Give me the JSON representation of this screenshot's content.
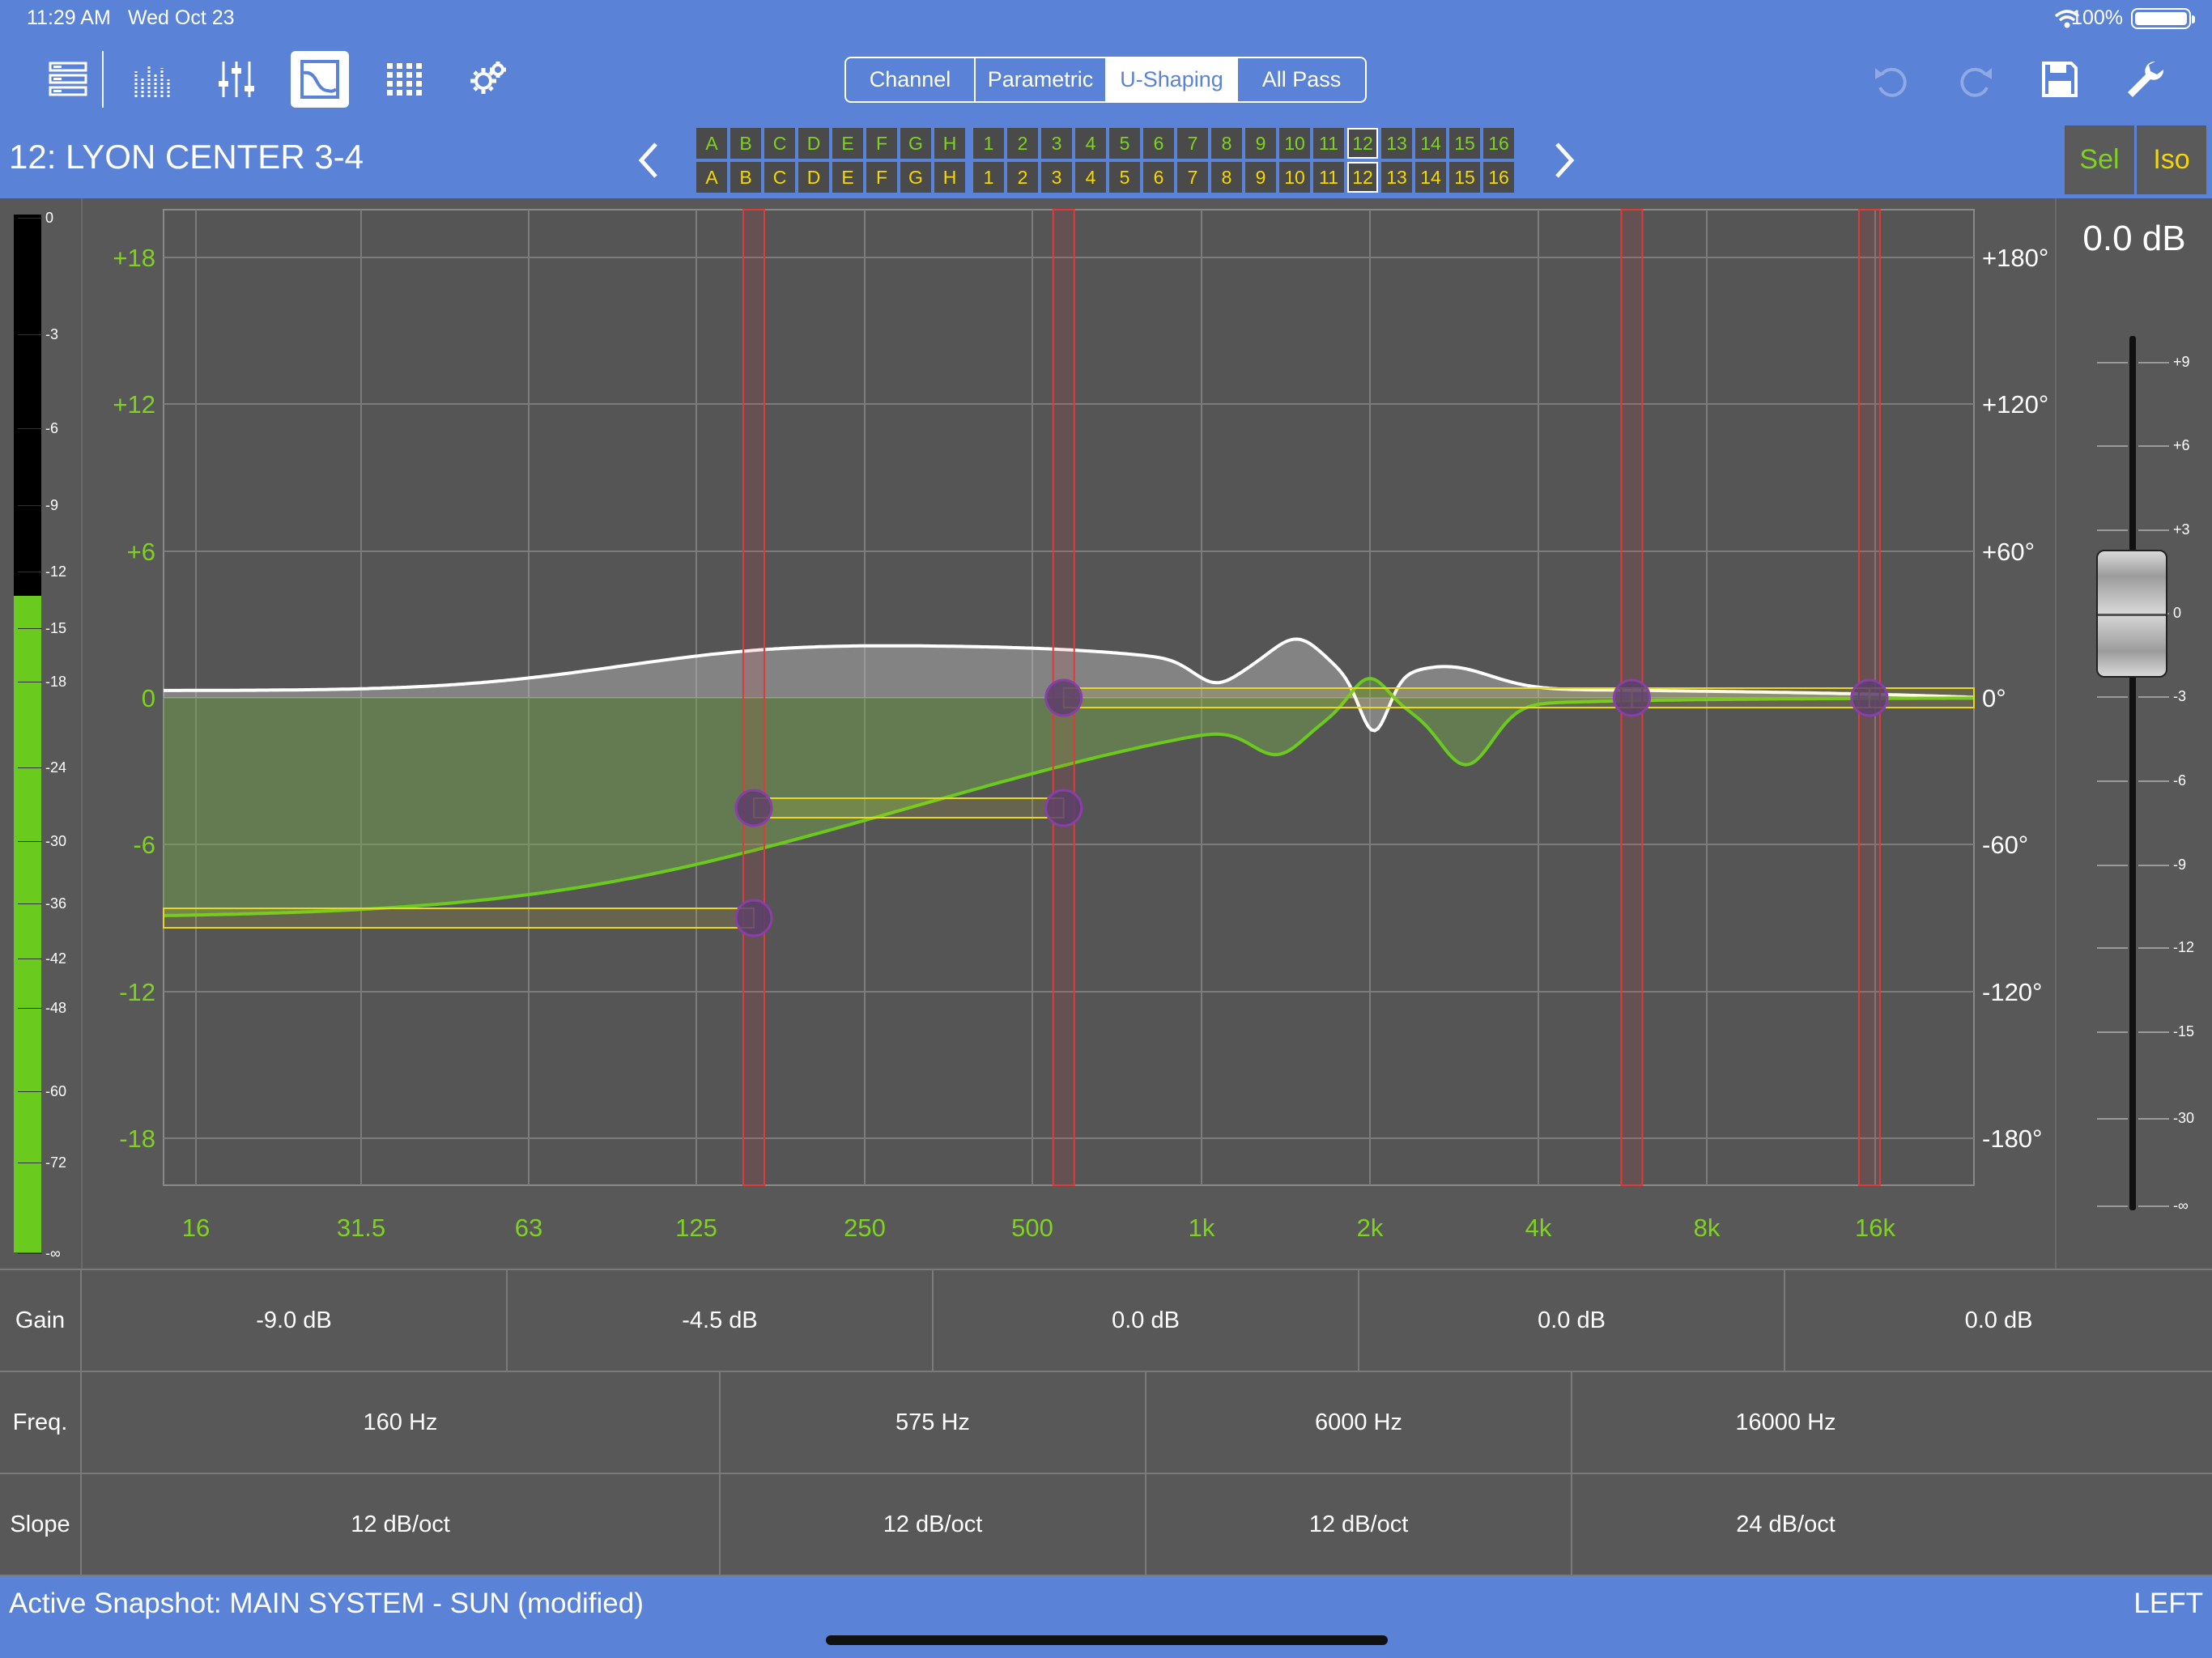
{
  "status_bar": {
    "time": "11:29 AM",
    "date": "Wed Oct 23",
    "battery": "100%"
  },
  "toolbar": {
    "left_icons": [
      "rack-icon",
      "spectrum-icon",
      "faders-icon",
      "eq-curve-icon",
      "matrix-grid-icon",
      "settings-gears-icon"
    ],
    "active_icon": "eq-curve-icon",
    "tabs": [
      {
        "label": "Channel",
        "active": false
      },
      {
        "label": "Parametric",
        "active": false
      },
      {
        "label": "U-Shaping",
        "active": true
      },
      {
        "label": "All Pass",
        "active": false
      }
    ],
    "right_icons": [
      "undo-icon",
      "redo-icon",
      "save-icon",
      "wrench-icon"
    ]
  },
  "channel": {
    "title": "12: LYON CENTER 3-4"
  },
  "channel_selector": {
    "letters": [
      "A",
      "B",
      "C",
      "D",
      "E",
      "F",
      "G",
      "H"
    ],
    "numbers": [
      "1",
      "2",
      "3",
      "4",
      "5",
      "6",
      "7",
      "8",
      "9",
      "10",
      "11",
      "12",
      "13",
      "14",
      "15",
      "16"
    ],
    "selected": "12"
  },
  "side_buttons": {
    "sel": "Sel",
    "iso": "Iso"
  },
  "graph": {
    "x_ticks": [
      "16",
      "31.5",
      "63",
      "125",
      "250",
      "500",
      "1k",
      "2k",
      "4k",
      "8k",
      "16k"
    ],
    "y_ticks_left": [
      "+18",
      "+12",
      "+6",
      "0",
      "-6",
      "-12",
      "-18"
    ],
    "y_ticks_right": [
      "+180°",
      "+120°",
      "+60°",
      "0°",
      "-60°",
      "-120°",
      "-180°"
    ],
    "bands": [
      {
        "freq_hz": 160,
        "gain_db": -9.0
      },
      {
        "freq_hz": 575,
        "gain_db": -4.5
      },
      {
        "freq_hz": 6000,
        "gain_db": 0.0
      },
      {
        "freq_hz": 16000,
        "gain_db": 0.0
      }
    ],
    "colors": {
      "magnitude": "#6acb1e",
      "phase": "#ffffff",
      "band_line": "#e03a3a",
      "handle_box": "#e8d820",
      "handle": "#5a3f6a"
    }
  },
  "meter": {
    "labels": [
      "0",
      "-3",
      "-6",
      "-9",
      "-12",
      "-15",
      "-18",
      "-24",
      "-30",
      "-36",
      "-42",
      "-48",
      "-60",
      "-72",
      "-∞"
    ],
    "level_label": "-15"
  },
  "fader": {
    "value": "0.0 dB",
    "labels": [
      "+9",
      "+6",
      "+3",
      "0",
      "-3",
      "-6",
      "-9",
      "-12",
      "-15",
      "-30",
      "-∞"
    ]
  },
  "params": {
    "gain_label": "Gain",
    "freq_label": "Freq.",
    "slope_label": "Slope",
    "gain": [
      "-9.0 dB",
      "-4.5 dB",
      "0.0 dB",
      "0.0 dB",
      "0.0 dB"
    ],
    "freq": [
      "160 Hz",
      "575 Hz",
      "6000 Hz",
      "16000 Hz"
    ],
    "slope": [
      "12 dB/oct",
      "12 dB/oct",
      "12 dB/oct",
      "24 dB/oct"
    ]
  },
  "footer": {
    "snapshot": "Active Snapshot: MAIN SYSTEM - SUN (modified)",
    "side": "LEFT"
  }
}
